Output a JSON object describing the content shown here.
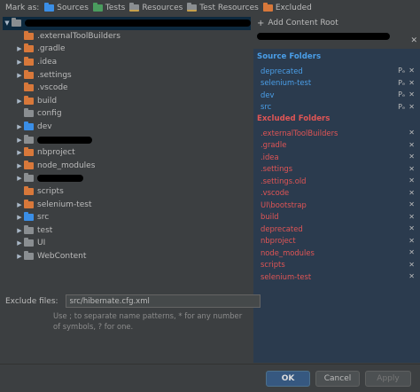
{
  "markbar": {
    "label": "Mark as:",
    "buttons": [
      {
        "label": "Sources",
        "icon": "blue-folder-icon"
      },
      {
        "label": "Tests",
        "icon": "green-folder-icon"
      },
      {
        "label": "Resources",
        "icon": "resources-folder-icon"
      },
      {
        "label": "Test Resources",
        "icon": "test-resources-folder-icon"
      },
      {
        "label": "Excluded",
        "icon": "orange-folder-icon"
      }
    ]
  },
  "tree": {
    "items": [
      {
        "name": ".externalToolBuilders",
        "expandable": false,
        "color": "orange"
      },
      {
        "name": ".gradle",
        "expandable": true,
        "color": "orange"
      },
      {
        "name": ".idea",
        "expandable": true,
        "color": "orange"
      },
      {
        "name": ".settings",
        "expandable": true,
        "color": "orange"
      },
      {
        "name": ".vscode",
        "expandable": false,
        "color": "orange"
      },
      {
        "name": "build",
        "expandable": true,
        "color": "orange"
      },
      {
        "name": "config",
        "expandable": false,
        "color": "gray"
      },
      {
        "name": "dev",
        "expandable": true,
        "color": "blue"
      },
      {
        "name": "",
        "expandable": true,
        "color": "gray"
      },
      {
        "name": "nbproject",
        "expandable": true,
        "color": "orange"
      },
      {
        "name": "node_modules",
        "expandable": true,
        "color": "orange"
      },
      {
        "name": "",
        "expandable": true,
        "color": "gray"
      },
      {
        "name": "scripts",
        "expandable": false,
        "color": "orange"
      },
      {
        "name": "selenium-test",
        "expandable": true,
        "color": "orange"
      },
      {
        "name": "src",
        "expandable": true,
        "color": "blue"
      },
      {
        "name": "test",
        "expandable": true,
        "color": "gray"
      },
      {
        "name": "UI",
        "expandable": true,
        "color": "gray"
      },
      {
        "name": "WebContent",
        "expandable": true,
        "color": "gray"
      }
    ]
  },
  "right": {
    "add_root": "Add Content Root",
    "source_title": "Source Folders",
    "sources": [
      "deprecated",
      "selenium-test",
      "dev",
      "src"
    ],
    "excluded_title": "Excluded Folders",
    "excluded": [
      ".externalToolBuilders",
      ".gradle",
      ".idea",
      ".settings",
      ".settings.old",
      ".vscode",
      "UI\\bootstrap",
      "build",
      "deprecated",
      "nbproject",
      "node_modules",
      "scripts",
      "selenium-test"
    ]
  },
  "exclude_files": {
    "label": "Exclude files:",
    "value": "src/hibernate.cfg.xml",
    "hint": "Use ; to separate name patterns, * for any number of symbols, ? for one."
  },
  "footer": {
    "ok": "OK",
    "cancel": "Cancel",
    "apply": "Apply"
  }
}
